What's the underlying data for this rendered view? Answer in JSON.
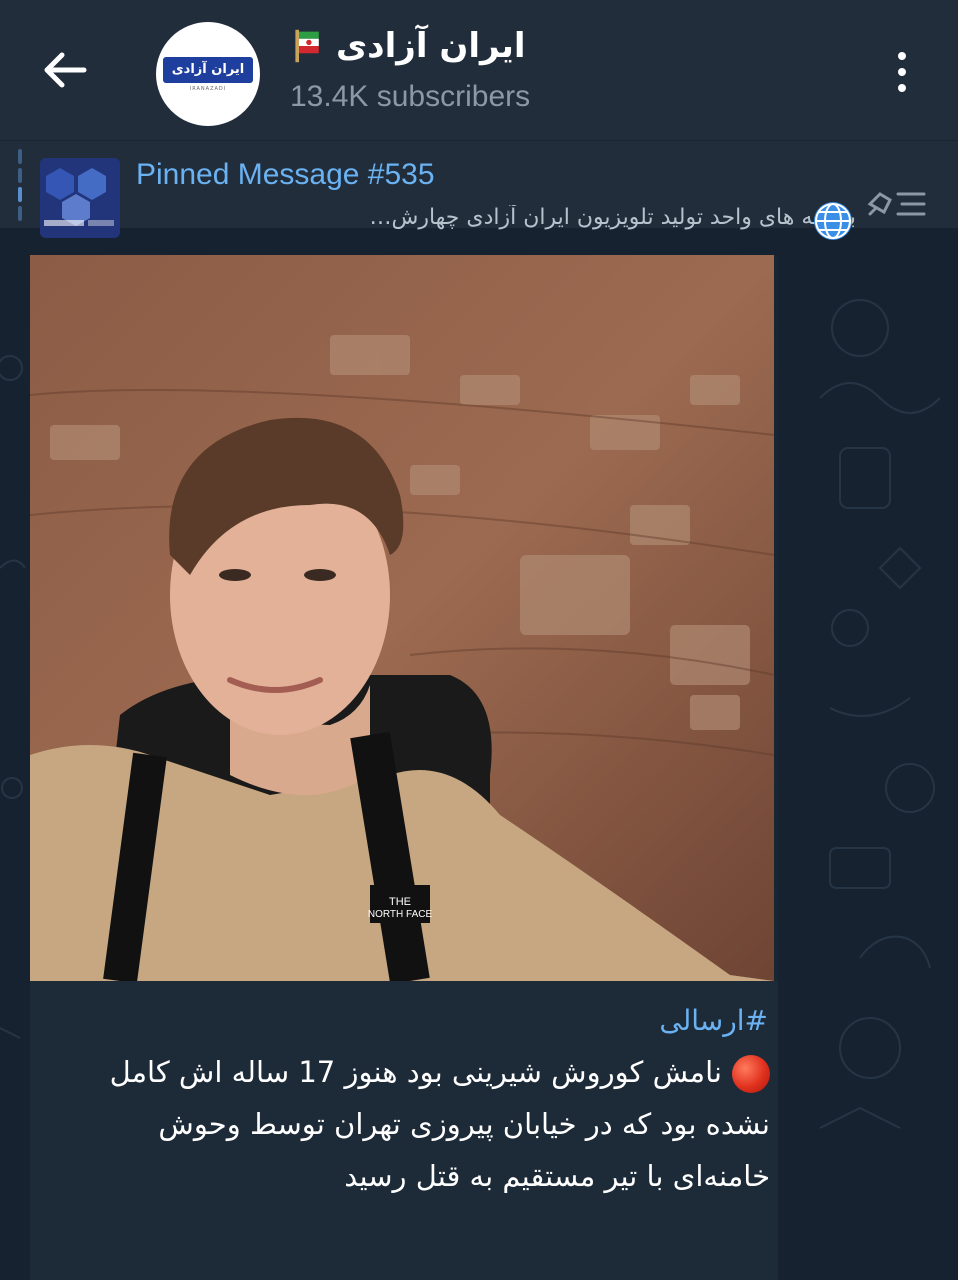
{
  "header": {
    "back_icon": "arrow-left-icon",
    "avatar_text": "ایران آزادی",
    "avatar_subtext": "IRANAZADI",
    "channel_title": "ایران آزادی",
    "subscribers": "13.4K subscribers",
    "menu_icon": "more-vertical-icon"
  },
  "pinned": {
    "title": "Pinned Message #535",
    "text": "برنامه های واحد تولید تلویزیون ایران آزادی  چهارش…",
    "globe_icon": "globe-icon",
    "list_icon": "pinned-list-icon"
  },
  "message": {
    "photo_alt": "photo",
    "hashtag": "#ارسالی",
    "text": "نامش کوروش شیرینی بود هنوز 17 ساله اش کامل نشده بود که در خیابان پیروزی تهران توسط وحوش خامنه‌ای با تیر مستقیم به قتل رسید"
  },
  "colors": {
    "header_bg": "#212d3b",
    "chat_bg": "#172230",
    "accent": "#6ab2f2",
    "muted": "#8b98a5"
  }
}
